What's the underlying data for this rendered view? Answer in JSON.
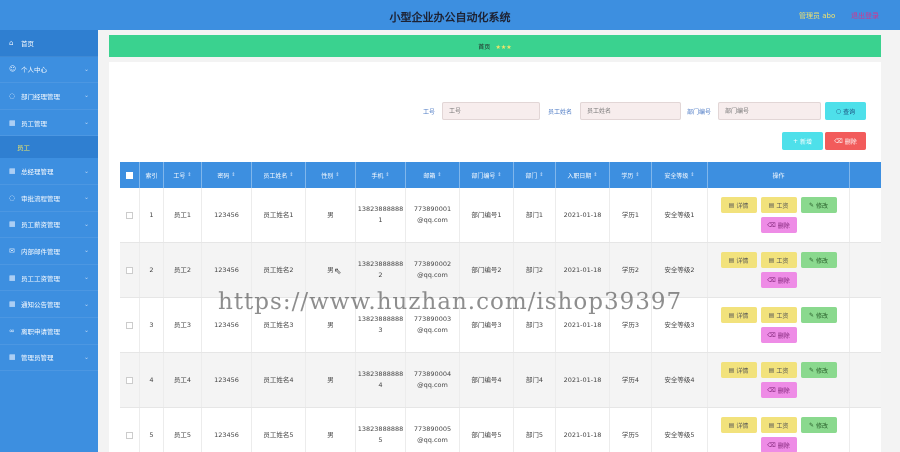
{
  "header": {
    "title": "小型企业办公自动化系统",
    "user_label": "管理员 abo",
    "logout_label": "退出登录"
  },
  "sidebar": {
    "items": [
      {
        "label": "首页",
        "icon": "home-icon"
      },
      {
        "label": "个人中心",
        "icon": "user-icon"
      },
      {
        "label": "部门经理管理",
        "icon": "circle-icon"
      },
      {
        "label": "员工管理",
        "icon": "grid-icon"
      },
      {
        "label": "总经理管理",
        "icon": "grid-icon"
      },
      {
        "label": "审批流程管理",
        "icon": "circle-icon"
      },
      {
        "label": "员工薪资管理",
        "icon": "grid-icon"
      },
      {
        "label": "内部邮件管理",
        "icon": "mail-icon"
      },
      {
        "label": "员工工资管理",
        "icon": "grid-icon"
      },
      {
        "label": "通知公告管理",
        "icon": "grid-icon"
      },
      {
        "label": "离职申请管理",
        "icon": "link-icon"
      },
      {
        "label": "管理员管理",
        "icon": "grid-icon"
      }
    ],
    "sub_item": "员工"
  },
  "breadcrumb": {
    "label": "首页",
    "stars": "★★★"
  },
  "search": {
    "id_label": "工号",
    "id_placeholder": "工号",
    "name_label": "员工姓名",
    "name_placeholder": "员工姓名",
    "dept_label": "部门编号",
    "dept_placeholder": "部门编号",
    "query_button": "查询"
  },
  "actions": {
    "add_button": "新增",
    "delete_button": "删除"
  },
  "table": {
    "headers": [
      "索引",
      "工号",
      "密码",
      "员工姓名",
      "性别",
      "手机",
      "邮箱",
      "部门编号",
      "部门",
      "入职日期",
      "学历",
      "安全等级",
      "操作"
    ],
    "rows": [
      {
        "index": "1",
        "id": "员工1",
        "pwd": "123456",
        "name": "员工姓名1",
        "sex": "男",
        "phone": "13823888888\n1",
        "email": "773890001\n@qq.com",
        "dept_no": "部门编号1",
        "dept": "部门1",
        "date": "2021-01-18",
        "edu": "学历1",
        "level": "安全等级1"
      },
      {
        "index": "2",
        "id": "员工2",
        "pwd": "123456",
        "name": "员工姓名2",
        "sex": "男",
        "phone": "13823888888\n2",
        "email": "773890002\n@qq.com",
        "dept_no": "部门编号2",
        "dept": "部门2",
        "date": "2021-01-18",
        "edu": "学历2",
        "level": "安全等级2"
      },
      {
        "index": "3",
        "id": "员工3",
        "pwd": "123456",
        "name": "员工姓名3",
        "sex": "男",
        "phone": "13823888888\n3",
        "email": "773890003\n@qq.com",
        "dept_no": "部门编号3",
        "dept": "部门3",
        "date": "2021-01-18",
        "edu": "学历3",
        "level": "安全等级3"
      },
      {
        "index": "4",
        "id": "员工4",
        "pwd": "123456",
        "name": "员工姓名4",
        "sex": "男",
        "phone": "13823888888\n4",
        "email": "773890004\n@qq.com",
        "dept_no": "部门编号4",
        "dept": "部门4",
        "date": "2021-01-18",
        "edu": "学历4",
        "level": "安全等级4"
      },
      {
        "index": "5",
        "id": "员工5",
        "pwd": "123456",
        "name": "员工姓名5",
        "sex": "男",
        "phone": "13823888888\n5",
        "email": "773890005\n@qq.com",
        "dept_no": "部门编号5",
        "dept": "部门5",
        "date": "2021-01-18",
        "edu": "学历5",
        "level": "安全等级5"
      }
    ],
    "ops": {
      "detail": "详情",
      "salary": "工资",
      "edit": "修改",
      "delete": "删除"
    }
  },
  "watermark": "https://www.huzhan.com/ishop39397",
  "colors": {
    "primary": "#3d8fe0",
    "green": "#3ad28f",
    "cyan": "#4ee0ea",
    "red": "#f25b5b"
  }
}
